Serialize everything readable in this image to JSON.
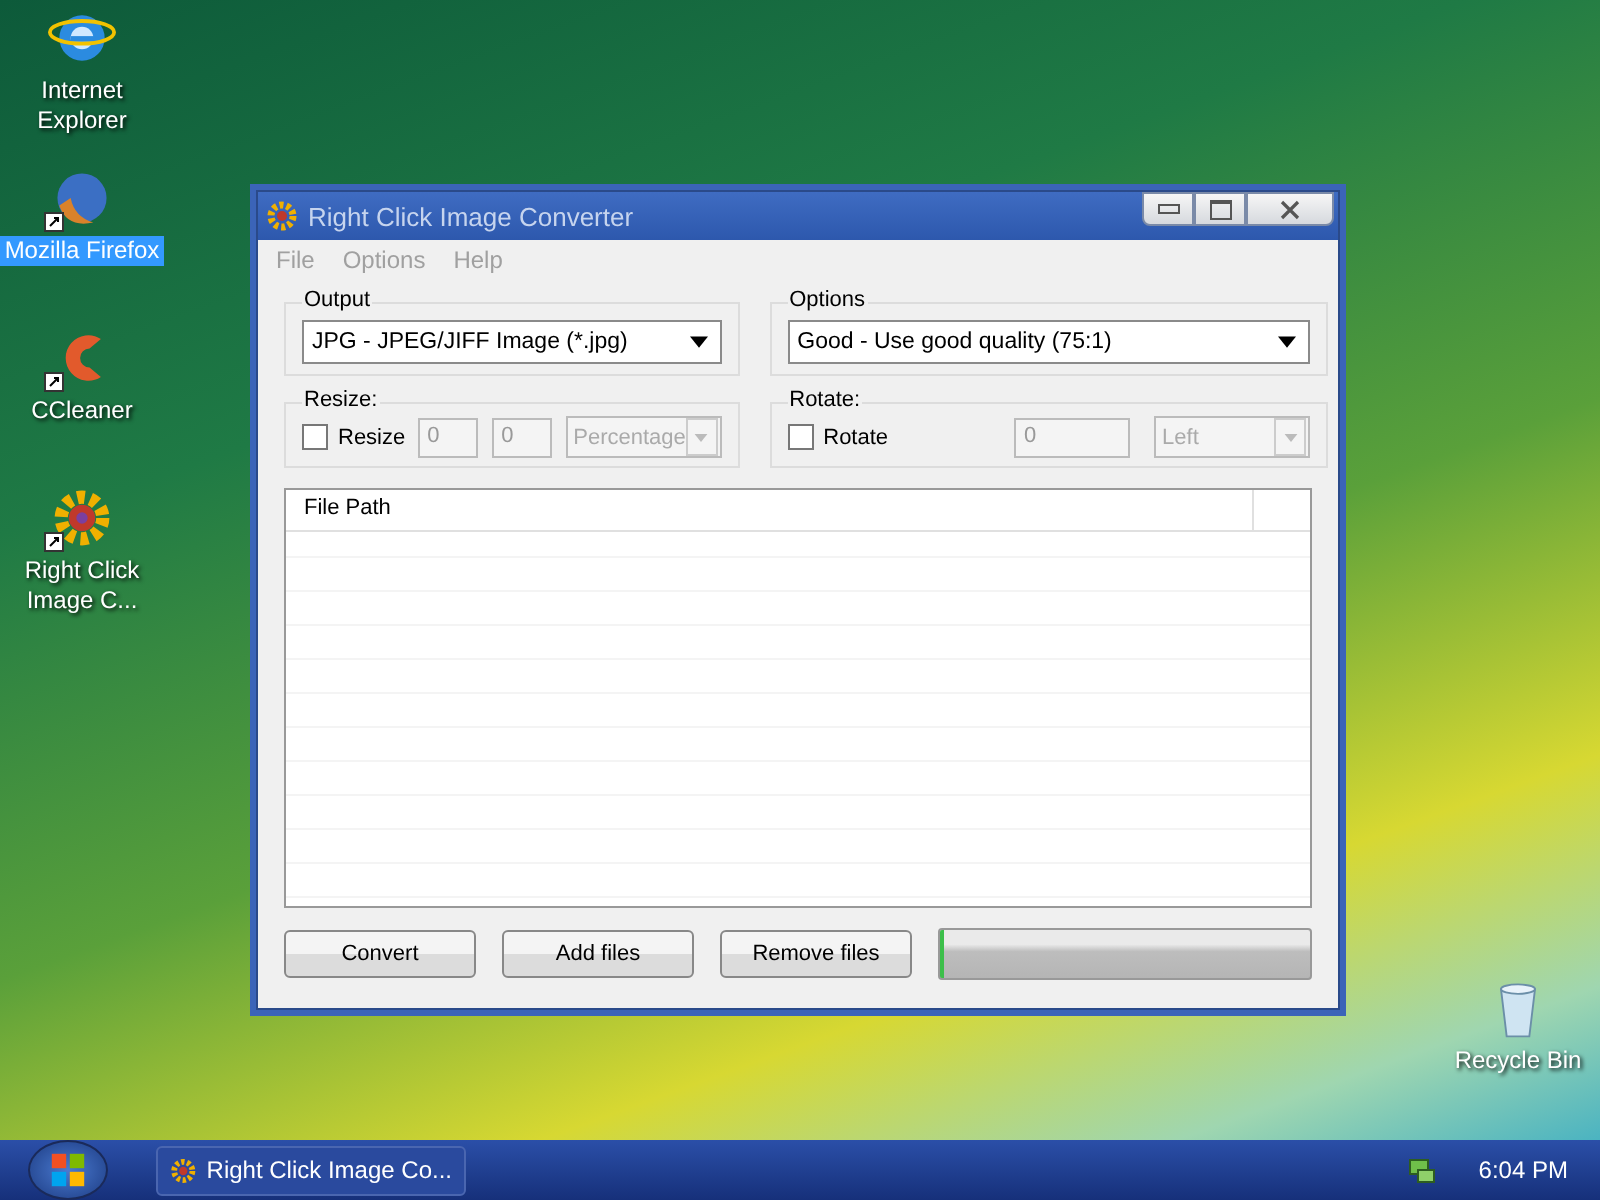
{
  "desktop_icons": [
    {
      "label": "Internet Explorer",
      "kind": "ie",
      "selected": false,
      "shortcut": false
    },
    {
      "label": "Mozilla Firefox",
      "kind": "firefox",
      "selected": true,
      "shortcut": true
    },
    {
      "label": "CCleaner",
      "kind": "ccleaner",
      "selected": false,
      "shortcut": true
    },
    {
      "label": "Right Click Image C...",
      "kind": "gear",
      "selected": false,
      "shortcut": true
    },
    {
      "label": "Recycle Bin",
      "kind": "bin",
      "selected": false,
      "shortcut": false
    }
  ],
  "window": {
    "title": "Right Click Image Converter"
  },
  "menu": [
    "File",
    "Options",
    "Help"
  ],
  "output": {
    "label": "Output",
    "value": "JPG - JPEG/JIFF Image (*.jpg)"
  },
  "options": {
    "label": "Options",
    "value": "Good - Use good quality (75:1)"
  },
  "resize": {
    "label": "Resize:",
    "checkbox": {
      "label": "Resize",
      "checked": false
    },
    "fields": [
      {
        "value": "0",
        "disabled": true
      },
      {
        "value": "0",
        "disabled": true
      }
    ],
    "unit": {
      "value": "Percentage",
      "disabled": true
    }
  },
  "rotate": {
    "label": "Rotate:",
    "checkbox": {
      "label": "Rotate",
      "checked": false
    },
    "fields": [
      {
        "value": "0",
        "disabled": true
      }
    ],
    "unit": {
      "value": "Left",
      "disabled": true
    }
  },
  "file_list": {
    "columns": [
      "File Path"
    ]
  },
  "buttons": [
    "Convert",
    "Add files",
    "Remove files"
  ],
  "progress": {
    "level": 0.01
  },
  "taskbar": {
    "tasks": [
      {
        "label": "Right Click Image Co...",
        "selected": false
      }
    ],
    "clock": "6:04 PM"
  }
}
